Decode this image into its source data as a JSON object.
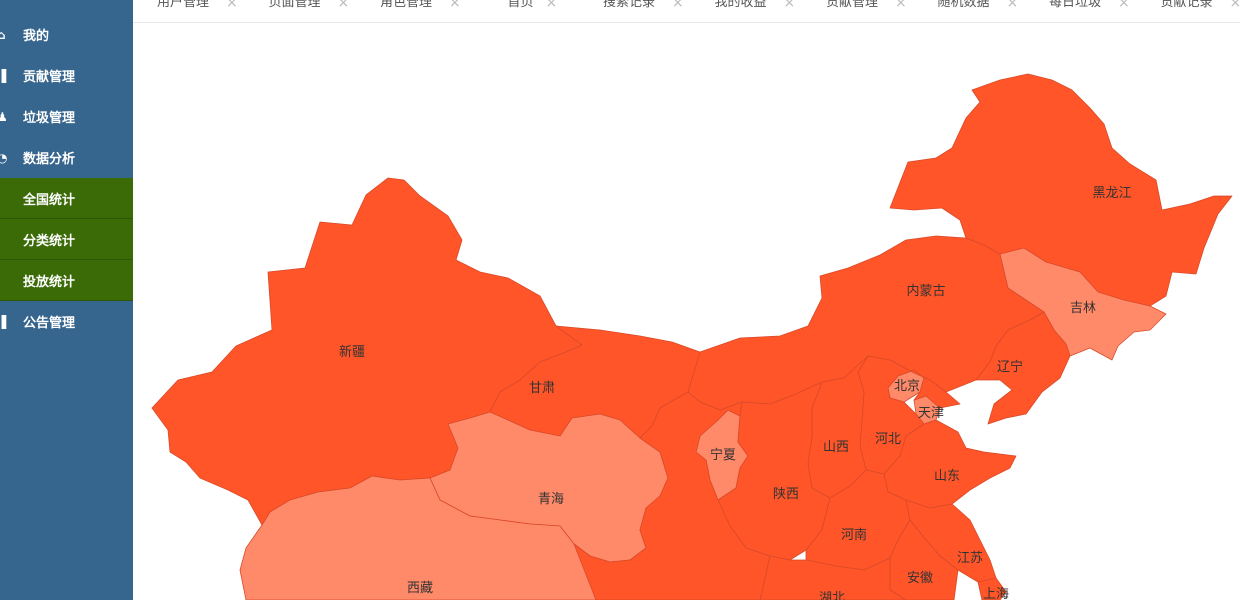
{
  "sidebar": {
    "menu": [
      {
        "label": "我的",
        "icon": "home-icon"
      },
      {
        "label": "贡献管理",
        "icon": "document-icon"
      },
      {
        "label": "垃圾管理",
        "icon": "user-icon"
      },
      {
        "label": "数据分析",
        "icon": "chart-icon"
      }
    ],
    "submenu": [
      {
        "label": "全国统计",
        "active": true
      },
      {
        "label": "分类统计"
      },
      {
        "label": "投放统计"
      }
    ],
    "after": [
      {
        "label": "公告管理",
        "icon": "announcement-icon"
      }
    ]
  },
  "tabs": [
    {
      "label": "用户管理"
    },
    {
      "label": "页面管理"
    },
    {
      "label": "角色管理"
    },
    {
      "label": "首页"
    },
    {
      "label": "搜索记录"
    },
    {
      "label": "我的收益"
    },
    {
      "label": "贡献管理"
    },
    {
      "label": "随机数据"
    },
    {
      "label": "每日垃圾"
    },
    {
      "label": "贡献记录"
    }
  ],
  "tab_close_glyph": "×",
  "colors": {
    "sidebar_bg": "#36658d",
    "submenu_bg": "#3a6b06",
    "map_high": "#ff5528",
    "map_low": "#ff8a6a"
  },
  "map": {
    "provinces": [
      {
        "name": "新疆",
        "level": "high"
      },
      {
        "name": "甘肃",
        "level": "high"
      },
      {
        "name": "内蒙古",
        "level": "high"
      },
      {
        "name": "黑龙江",
        "level": "high"
      },
      {
        "name": "吉林",
        "level": "low"
      },
      {
        "name": "辽宁",
        "level": "high"
      },
      {
        "name": "北京",
        "level": "low"
      },
      {
        "name": "天津",
        "level": "low"
      },
      {
        "name": "河北",
        "level": "high"
      },
      {
        "name": "山西",
        "level": "high"
      },
      {
        "name": "宁夏",
        "level": "low"
      },
      {
        "name": "陕西",
        "level": "high"
      },
      {
        "name": "山东",
        "level": "high"
      },
      {
        "name": "河南",
        "level": "high"
      },
      {
        "name": "江苏",
        "level": "high"
      },
      {
        "name": "安徽",
        "level": "high"
      },
      {
        "name": "上海",
        "level": "high"
      },
      {
        "name": "湖北",
        "level": "high"
      },
      {
        "name": "青海",
        "level": "low"
      },
      {
        "name": "西藏",
        "level": "low"
      }
    ]
  }
}
